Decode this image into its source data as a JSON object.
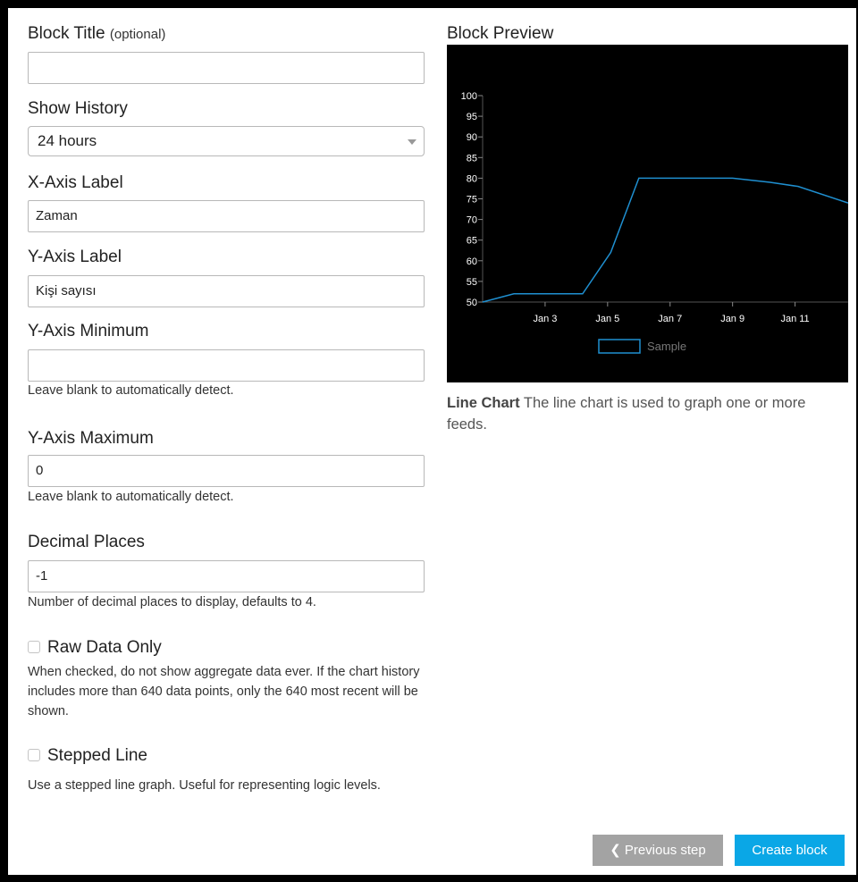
{
  "form": {
    "block_title": {
      "label": "Block Title",
      "optional_note": "(optional)",
      "value": ""
    },
    "show_history": {
      "label": "Show History",
      "selected": "24 hours"
    },
    "x_axis_label": {
      "label": "X-Axis Label",
      "value": "Zaman"
    },
    "y_axis_label": {
      "label": "Y-Axis Label",
      "value": "Kişi sayısı"
    },
    "y_axis_minimum": {
      "label": "Y-Axis Minimum",
      "value": "",
      "help": "Leave blank to automatically detect."
    },
    "y_axis_maximum": {
      "label": "Y-Axis Maximum",
      "value": "0",
      "help": "Leave blank to automatically detect."
    },
    "decimal_places": {
      "label": "Decimal Places",
      "value": "-1",
      "help": "Number of decimal places to display, defaults to 4."
    },
    "raw_data_only": {
      "label": "Raw Data Only",
      "checked": false,
      "help": "When checked, do not show aggregate data ever. If the chart history includes more than 640 data points, only the 640 most recent will be shown."
    },
    "stepped_line": {
      "label": "Stepped Line",
      "checked": false,
      "help": "Use a stepped line graph. Useful for representing logic levels."
    }
  },
  "preview": {
    "heading": "Block Preview",
    "description_strong": "Line Chart",
    "description_text": " The line chart is used to graph one or more feeds."
  },
  "chart_data": {
    "type": "line",
    "title": "",
    "xlabel": "",
    "ylabel": "",
    "ylim": [
      50,
      100
    ],
    "yticks": [
      50,
      55,
      60,
      65,
      70,
      75,
      80,
      85,
      90,
      95,
      100
    ],
    "xticks": [
      "Jan 3",
      "Jan 5",
      "Jan 7",
      "Jan 9",
      "Jan 11"
    ],
    "xlim": [
      1.0,
      12.7
    ],
    "series": [
      {
        "name": "Sample",
        "color": "#1f8fd0",
        "x": [
          1.0,
          2.0,
          4.2,
          5.1,
          6.0,
          7.0,
          8.0,
          9.0,
          10.2,
          11.1,
          12.7
        ],
        "values": [
          50,
          52,
          52,
          62,
          80,
          80,
          80,
          80,
          79,
          78,
          74
        ]
      }
    ],
    "legend_position": "bottom-center",
    "grid": false,
    "background": "#000000",
    "text_color": "#ffffff"
  },
  "actions": {
    "previous_label": "Previous step",
    "create_label": "Create block"
  }
}
